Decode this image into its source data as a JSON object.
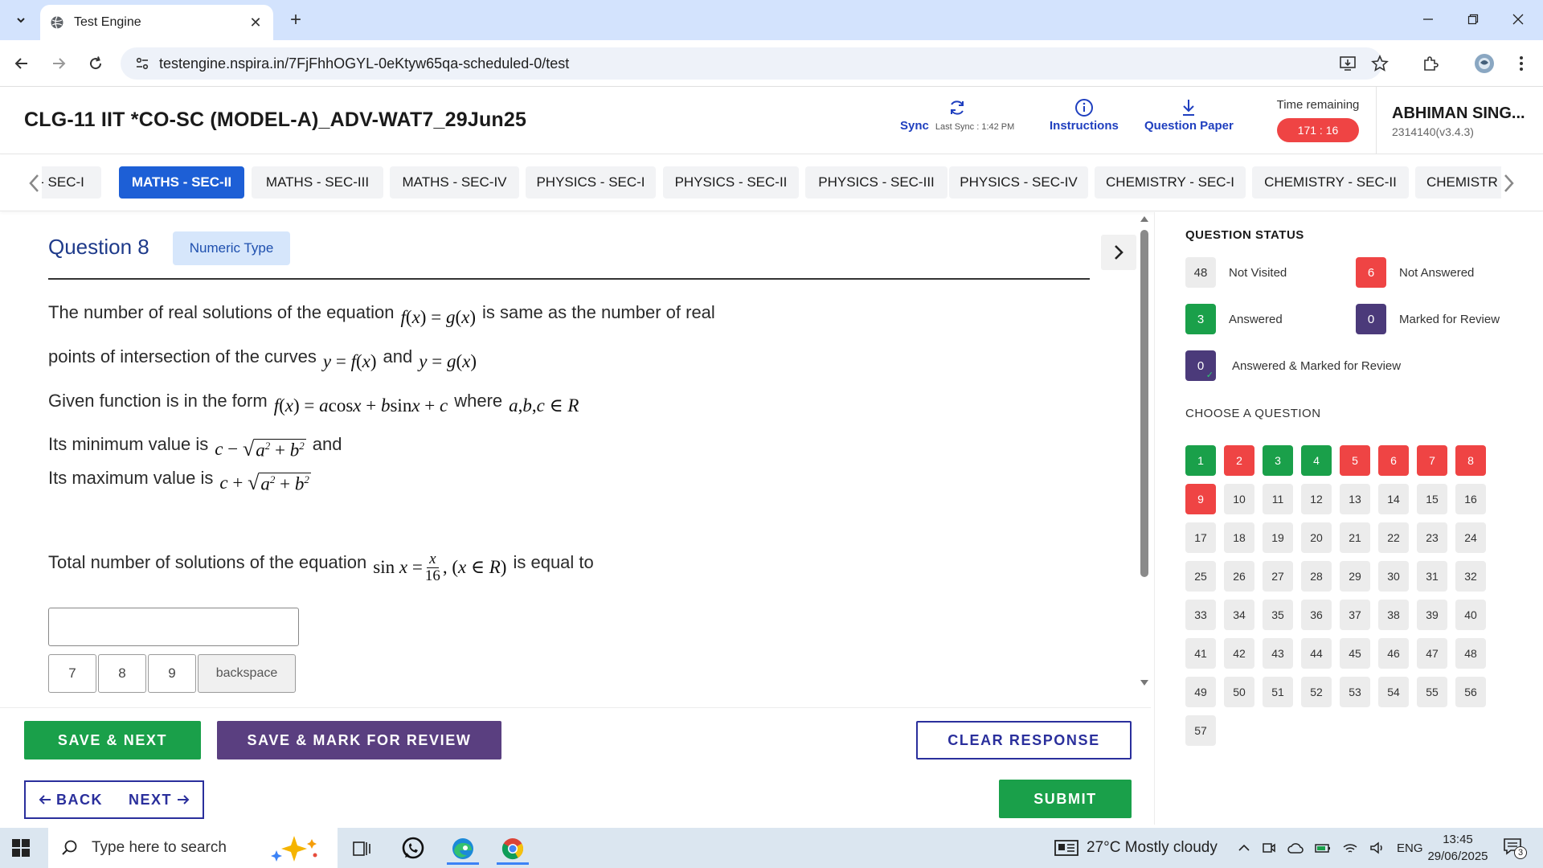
{
  "browser": {
    "tab_title": "Test Engine",
    "url": "testengine.nspira.in/7FjFhhOGYL-0eKtyw65qa-scheduled-0/test"
  },
  "header": {
    "test_title": "CLG-11 IIT *CO-SC (MODEL-A)_ADV-WAT7_29Jun25",
    "sync_label": "Sync",
    "last_sync": "Last Sync : 1:42 PM",
    "instructions_label": "Instructions",
    "question_paper_label": "Question Paper",
    "time_remaining_label": "Time remaining",
    "time_remaining": "171 : 16",
    "user_name": "ABHIMAN SING...",
    "user_id": "2314140(v3.4.3)"
  },
  "sections": [
    {
      "label": "S - SEC-I",
      "active": false
    },
    {
      "label": "MATHS - SEC-II",
      "active": true
    },
    {
      "label": "MATHS - SEC-III",
      "active": false
    },
    {
      "label": "MATHS - SEC-IV",
      "active": false
    },
    {
      "label": "PHYSICS - SEC-I",
      "active": false
    },
    {
      "label": "PHYSICS - SEC-II",
      "active": false
    },
    {
      "label": "PHYSICS - SEC-III",
      "active": false
    },
    {
      "label": "PHYSICS - SEC-IV",
      "active": false
    },
    {
      "label": "CHEMISTRY - SEC-I",
      "active": false
    },
    {
      "label": "CHEMISTRY - SEC-II",
      "active": false
    },
    {
      "label": "CHEMISTR",
      "active": false
    }
  ],
  "question": {
    "title": "Question 8",
    "type": "Numeric Type",
    "line1_a": "The number of real solutions of the equation",
    "line1_b": "is same as the number of real",
    "line2_a": "points of intersection of the curves",
    "line2_b": "and",
    "line3_a": "Given function is in the form",
    "line3_b": "where",
    "line4_a": "Its minimum value is",
    "line4_b": "and",
    "line5_a": "Its maximum value is",
    "line6_a": "Total number of solutions of the equation",
    "line6_b": "is equal to",
    "answer_value": "",
    "keypad": [
      "7",
      "8",
      "9",
      "backspace"
    ]
  },
  "actions": {
    "save_next": "SAVE & NEXT",
    "save_mark": "SAVE & MARK FOR REVIEW",
    "clear": "CLEAR RESPONSE",
    "back": "BACK",
    "next": "NEXT",
    "submit": "SUBMIT"
  },
  "status": {
    "heading": "QUESTION STATUS",
    "not_visited_count": "48",
    "not_visited_label": "Not Visited",
    "not_answered_count": "6",
    "not_answered_label": "Not Answered",
    "answered_count": "3",
    "answered_label": "Answered",
    "marked_count": "0",
    "marked_label": "Marked for Review",
    "answered_marked_count": "0",
    "answered_marked_label": "Answered & Marked for Review",
    "choose_heading": "CHOOSE A QUESTION"
  },
  "question_grid": [
    {
      "n": "1",
      "s": "answered"
    },
    {
      "n": "2",
      "s": "not_answered"
    },
    {
      "n": "3",
      "s": "answered"
    },
    {
      "n": "4",
      "s": "answered"
    },
    {
      "n": "5",
      "s": "not_answered"
    },
    {
      "n": "6",
      "s": "not_answered"
    },
    {
      "n": "7",
      "s": "not_answered"
    },
    {
      "n": "8",
      "s": "not_answered"
    },
    {
      "n": "9",
      "s": "not_answered"
    },
    {
      "n": "10",
      "s": "not_visited"
    },
    {
      "n": "11",
      "s": "not_visited"
    },
    {
      "n": "12",
      "s": "not_visited"
    },
    {
      "n": "13",
      "s": "not_visited"
    },
    {
      "n": "14",
      "s": "not_visited"
    },
    {
      "n": "15",
      "s": "not_visited"
    },
    {
      "n": "16",
      "s": "not_visited"
    },
    {
      "n": "17",
      "s": "not_visited"
    },
    {
      "n": "18",
      "s": "not_visited"
    },
    {
      "n": "19",
      "s": "not_visited"
    },
    {
      "n": "20",
      "s": "not_visited"
    },
    {
      "n": "21",
      "s": "not_visited"
    },
    {
      "n": "22",
      "s": "not_visited"
    },
    {
      "n": "23",
      "s": "not_visited"
    },
    {
      "n": "24",
      "s": "not_visited"
    },
    {
      "n": "25",
      "s": "not_visited"
    },
    {
      "n": "26",
      "s": "not_visited"
    },
    {
      "n": "27",
      "s": "not_visited"
    },
    {
      "n": "28",
      "s": "not_visited"
    },
    {
      "n": "29",
      "s": "not_visited"
    },
    {
      "n": "30",
      "s": "not_visited"
    },
    {
      "n": "31",
      "s": "not_visited"
    },
    {
      "n": "32",
      "s": "not_visited"
    },
    {
      "n": "33",
      "s": "not_visited"
    },
    {
      "n": "34",
      "s": "not_visited"
    },
    {
      "n": "35",
      "s": "not_visited"
    },
    {
      "n": "36",
      "s": "not_visited"
    },
    {
      "n": "37",
      "s": "not_visited"
    },
    {
      "n": "38",
      "s": "not_visited"
    },
    {
      "n": "39",
      "s": "not_visited"
    },
    {
      "n": "40",
      "s": "not_visited"
    },
    {
      "n": "41",
      "s": "not_visited"
    },
    {
      "n": "42",
      "s": "not_visited"
    },
    {
      "n": "43",
      "s": "not_visited"
    },
    {
      "n": "44",
      "s": "not_visited"
    },
    {
      "n": "45",
      "s": "not_visited"
    },
    {
      "n": "46",
      "s": "not_visited"
    },
    {
      "n": "47",
      "s": "not_visited"
    },
    {
      "n": "48",
      "s": "not_visited"
    },
    {
      "n": "49",
      "s": "not_visited"
    },
    {
      "n": "50",
      "s": "not_visited"
    },
    {
      "n": "51",
      "s": "not_visited"
    },
    {
      "n": "52",
      "s": "not_visited"
    },
    {
      "n": "53",
      "s": "not_visited"
    },
    {
      "n": "54",
      "s": "not_visited"
    },
    {
      "n": "55",
      "s": "not_visited"
    },
    {
      "n": "56",
      "s": "not_visited"
    },
    {
      "n": "57",
      "s": "not_visited"
    }
  ],
  "taskbar": {
    "search_placeholder": "Type here to search",
    "weather": "27°C  Mostly cloudy",
    "lang": "ENG",
    "time": "13:45",
    "date": "29/06/2025",
    "notification_count": "3"
  },
  "colors": {
    "answered": "#1aa04a",
    "not_answered": "#ef4444",
    "not_visited": "#ececec",
    "marked": "#4b3a7a",
    "accent": "#1d5fd6"
  }
}
